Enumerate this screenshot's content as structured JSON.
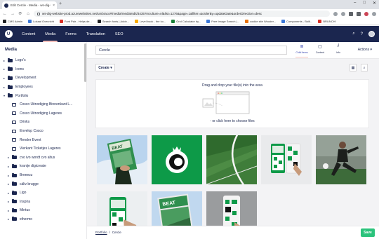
{
  "browser": {
    "tab_title": "Edit Cercle - Media - ws-dig-ws...",
    "tab_close": "×",
    "new_tab": "+",
    "window_controls": [
      "–",
      "□",
      "✕"
    ],
    "back": "←",
    "forward": "→",
    "reload": "⟳",
    "home": "⌂",
    "url": "ws-dig-website-prod.azurewebsites.net/umbraco#/media/media/edit/3435?mculture=nl&list=1276&page=1&filter=&orderBy=updateDate&orderDirection=desc",
    "bookmarks": [
      {
        "label": "CMS Admin",
        "color": "#202124"
      },
      {
        "label": "Lokaal Overzicht",
        "color": "#3c78d8"
      },
      {
        "label": "Font Pair - Helps de...",
        "color": "#d93025"
      },
      {
        "label": "Search fonts | Adob...",
        "color": "#202124"
      },
      {
        "label": "Level book - the ko...",
        "color": "#f9ab00"
      },
      {
        "label": "Grid Calculator by...",
        "color": "#188038"
      },
      {
        "label": "Free Image Search |...",
        "color": "#3c78d8"
      },
      {
        "label": "cookie site Wooder...",
        "color": "#e8710a"
      },
      {
        "label": "Components - Boilt...",
        "color": "#3c78d8"
      },
      {
        "label": "BRUNCH!",
        "color": "#d93025"
      }
    ]
  },
  "header": {
    "logo": "U",
    "sections": [
      "Content",
      "Media",
      "Forms",
      "Translation",
      "SEO"
    ],
    "active_section": "Media",
    "search_icon": "⌕",
    "help_icon": "?"
  },
  "sidebar": {
    "title": "Media",
    "items": [
      {
        "label": "Logo's",
        "type": "folder",
        "caret": "▸",
        "level": 0
      },
      {
        "label": "Icons",
        "type": "folder",
        "caret": "▸",
        "level": 0
      },
      {
        "label": "Development",
        "type": "folder",
        "caret": "▸",
        "level": 0
      },
      {
        "label": "Employees",
        "type": "folder",
        "caret": "▸",
        "level": 0
      },
      {
        "label": "Portfolio",
        "type": "folder",
        "caret": "▾",
        "level": 0
      },
      {
        "label": "Cosco Uitnodiging Binnenkant L...",
        "type": "image",
        "caret": "",
        "level": 1
      },
      {
        "label": "Cosco Uitnodiging Lageres",
        "type": "image",
        "caret": "",
        "level": 1
      },
      {
        "label": "Drinks",
        "type": "image",
        "caret": "",
        "level": 1
      },
      {
        "label": "Envelop Cosco",
        "type": "image",
        "caret": "",
        "level": 1
      },
      {
        "label": "Render Event",
        "type": "image",
        "caret": "",
        "level": 1
      },
      {
        "label": "Vierkant Ticketjes Lageres",
        "type": "image",
        "caret": "",
        "level": 1
      },
      {
        "label": "cvo ivo wordt cvo altus",
        "type": "folder",
        "caret": "▸",
        "level": 1
      },
      {
        "label": "kranije digicreate",
        "type": "folder",
        "caret": "▸",
        "level": 1
      },
      {
        "label": "Breeezz",
        "type": "folder",
        "caret": "▸",
        "level": 1
      },
      {
        "label": "cáliv brugge",
        "type": "folder",
        "caret": "▸",
        "level": 1
      },
      {
        "label": "Ligo",
        "type": "folder",
        "caret": "▸",
        "level": 1
      },
      {
        "label": "Inspira",
        "type": "folder",
        "caret": "▸",
        "level": 1
      },
      {
        "label": "Mintus",
        "type": "folder",
        "caret": "▸",
        "level": 1
      },
      {
        "label": "xthermo",
        "type": "folder",
        "caret": "▸",
        "level": 1
      }
    ]
  },
  "editor": {
    "name_value": "Cercle",
    "apps": [
      {
        "label": "Child items",
        "icon": "≣"
      },
      {
        "label": "Content",
        "icon": "▢"
      },
      {
        "label": "Info",
        "icon": "i"
      }
    ],
    "active_app": "Child items",
    "actions_label": "Actions",
    "actions_caret": "▾",
    "create_label": "Create",
    "create_caret": "▾",
    "list_view_icon": "▦",
    "search_icon": "⌕",
    "dropzone_text": "Drag and drop your file(s) into the area",
    "dropzone_link": "- or click here to choose files",
    "thumbnails": [
      "poster-hand",
      "logo-green",
      "pitch",
      "phones-mockup",
      "football-player",
      "phone-hand",
      "poster-sky",
      "phone-grey"
    ]
  },
  "footer": {
    "breadcrumb": [
      "Portfolio",
      "Cercle"
    ],
    "separator": "/",
    "save_label": "Save"
  },
  "colors": {
    "header": "#1b264f",
    "accent": "#f5c1bc",
    "save": "#2bc37c",
    "brand_green": "#0d9a48"
  }
}
